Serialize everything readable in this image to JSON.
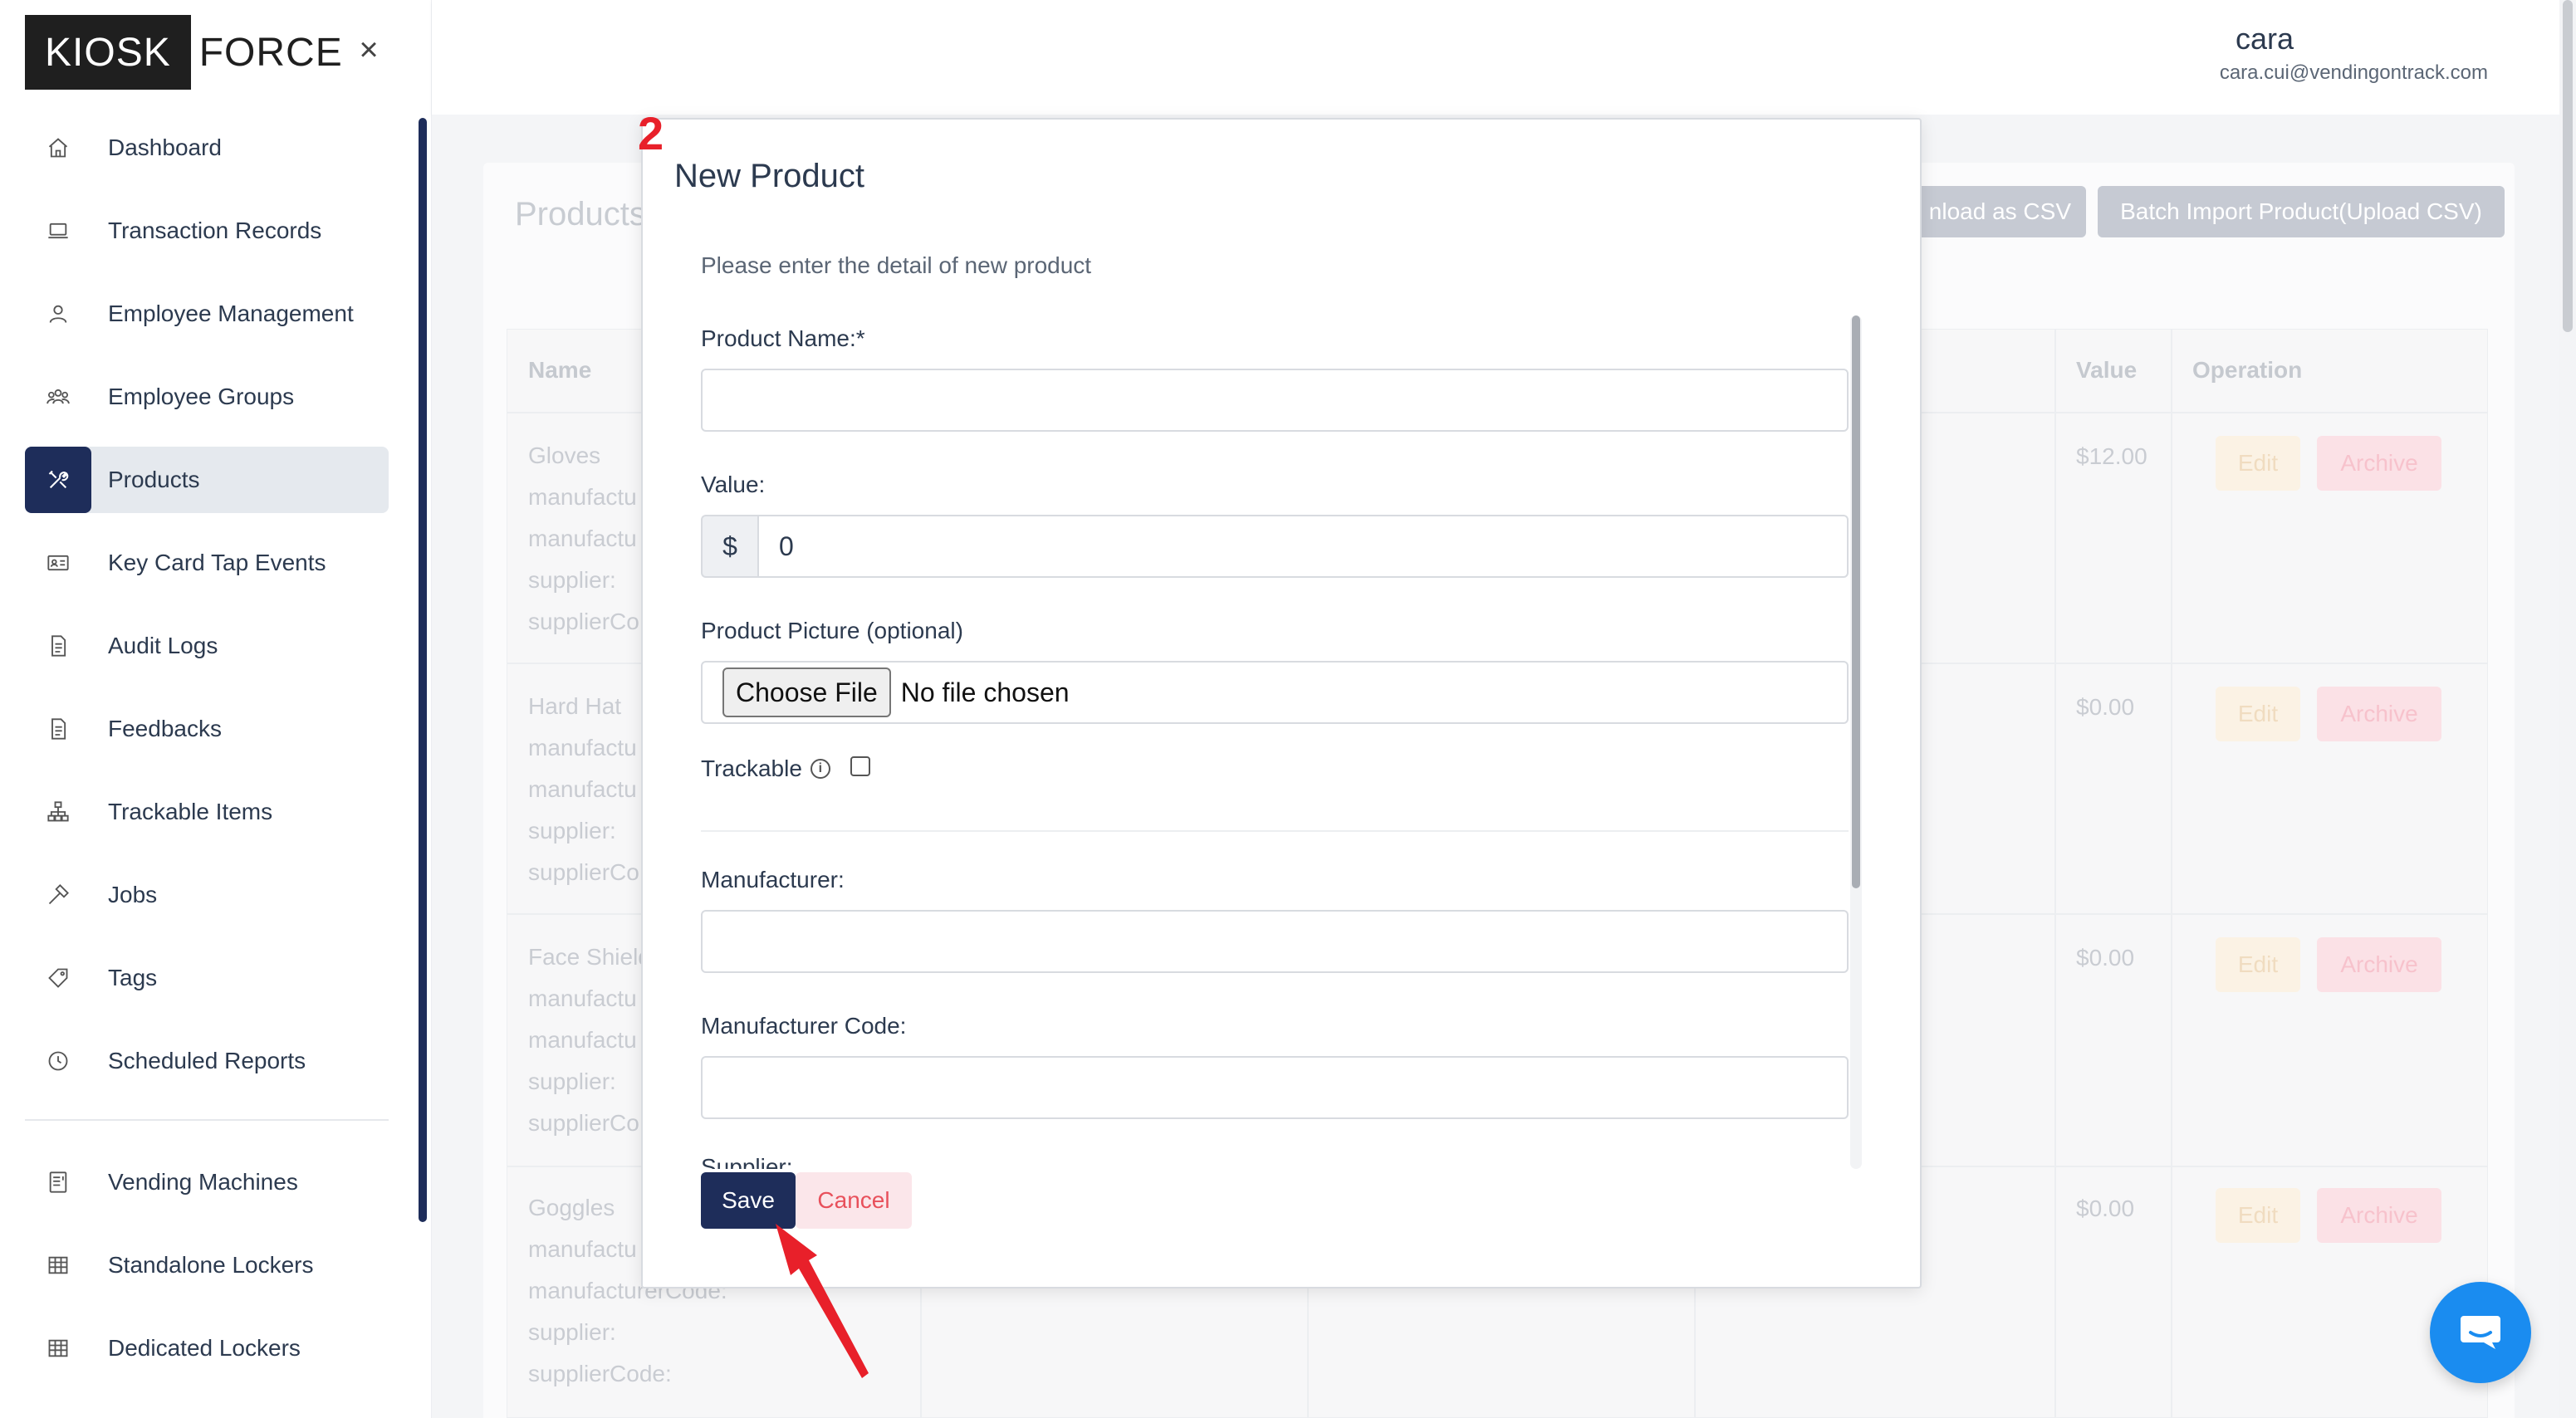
{
  "logo": {
    "part1": "KIOSK",
    "part2": "FORCE"
  },
  "sidebar": {
    "close_glyph": "×",
    "items": [
      {
        "label": "Dashboard",
        "icon": "home-icon"
      },
      {
        "label": "Transaction Records",
        "icon": "laptop-icon"
      },
      {
        "label": "Employee Management",
        "icon": "user-icon"
      },
      {
        "label": "Employee Groups",
        "icon": "users-icon"
      },
      {
        "label": "Products",
        "icon": "tools-icon",
        "active": true
      },
      {
        "label": "Key Card Tap Events",
        "icon": "id-card-icon"
      },
      {
        "label": "Audit Logs",
        "icon": "document-icon"
      },
      {
        "label": "Feedbacks",
        "icon": "document-icon"
      },
      {
        "label": "Trackable Items",
        "icon": "hierarchy-icon"
      },
      {
        "label": "Jobs",
        "icon": "hammer-icon"
      },
      {
        "label": "Tags",
        "icon": "tag-icon"
      },
      {
        "label": "Scheduled Reports",
        "icon": "clock-icon"
      }
    ],
    "items2": [
      {
        "label": "Vending Machines",
        "icon": "vending-icon"
      },
      {
        "label": "Standalone Lockers",
        "icon": "grid-icon"
      },
      {
        "label": "Dedicated Lockers",
        "icon": "grid-icon"
      }
    ]
  },
  "header": {
    "user_name": "cara",
    "user_email": "cara.cui@vendingontrack.com"
  },
  "background": {
    "title": "Products",
    "download_csv": "nload as CSV",
    "batch_import": "Batch Import Product(Upload CSV)",
    "columns": {
      "name": "Name",
      "value": "Value",
      "operation": "Operation"
    },
    "rows": [
      {
        "lines": [
          "Gloves",
          "manufactu",
          "manufactu",
          "supplier:",
          "supplierCo"
        ],
        "value": "$12.00"
      },
      {
        "lines": [
          "Hard Hat",
          "manufactu",
          "manufactu",
          "supplier:",
          "supplierCo"
        ],
        "value": "$0.00"
      },
      {
        "lines": [
          "Face Shield",
          "manufactu",
          "manufactu",
          "supplier:",
          "supplierCo"
        ],
        "value": "$0.00"
      },
      {
        "lines": [
          "Goggles",
          "manufactu",
          "manufacturerCode:",
          "supplier:",
          "supplierCode:"
        ],
        "value": "$0.00"
      }
    ],
    "edit_label": "Edit",
    "archive_label": "Archive"
  },
  "modal": {
    "step_number": "2",
    "title": "New Product",
    "description": "Please enter the detail of new product",
    "fields": {
      "product_name_label": "Product Name:*",
      "product_name_value": "",
      "value_label": "Value:",
      "value_prefix": "$",
      "value_value": "0",
      "picture_label": "Product Picture (optional)",
      "choose_file_label": "Choose File",
      "file_status": "No file chosen",
      "trackable_label": "Trackable",
      "info_glyph": "i",
      "manufacturer_label": "Manufacturer:",
      "manufacturer_value": "",
      "manufacturer_code_label": "Manufacturer Code:",
      "manufacturer_code_value": "",
      "supplier_label": "Supplier:"
    },
    "save_label": "Save",
    "cancel_label": "Cancel"
  },
  "colors": {
    "primary": "#1e2d5a",
    "annotation": "#e8202a",
    "chat": "#1a8cf0"
  }
}
